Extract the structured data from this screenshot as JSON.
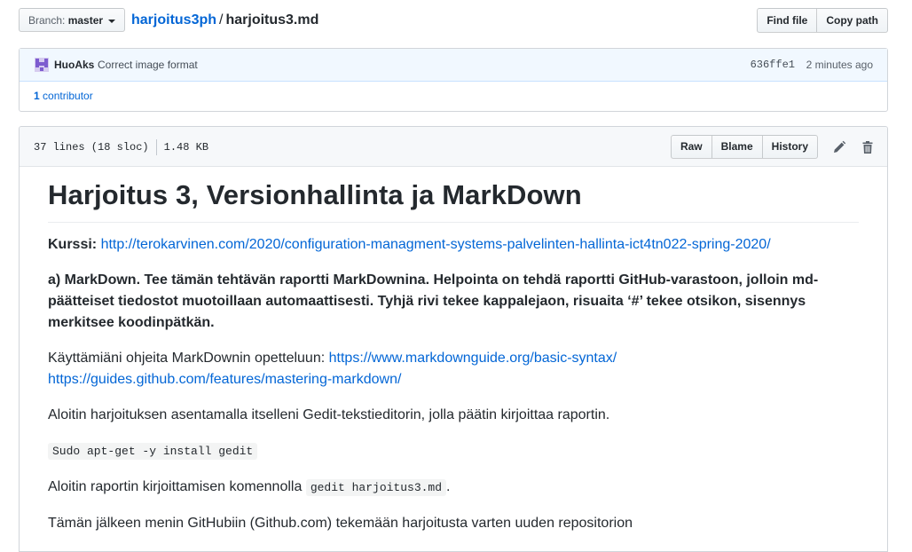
{
  "topbar": {
    "branch_label": "Branch:",
    "branch_name": "master",
    "repo": "harjoitus3ph",
    "separator": "/",
    "file": "harjoitus3.md",
    "find_file": "Find file",
    "copy_path": "Copy path"
  },
  "commit": {
    "author": "HuoAks",
    "message": "Correct image format",
    "sha": "636ffe1",
    "time": "2 minutes ago",
    "contributors_count": "1",
    "contributors_label": "contributor"
  },
  "file": {
    "lines": "37 lines (18 sloc)",
    "size": "1.48 KB",
    "raw": "Raw",
    "blame": "Blame",
    "history": "History"
  },
  "content": {
    "title": "Harjoitus 3, Versionhallinta ja MarkDown",
    "course_label": "Kurssi:",
    "course_link": "http://terokarvinen.com/2020/configuration-managment-systems-palvelinten-hallinta-ict4tn022-spring-2020/",
    "task_a": "a) MarkDown. Tee tämän tehtävän raportti MarkDownina. Helpointa on tehdä raportti GitHub-varastoon, jolloin md-päätteiset tiedostot muotoillaan automaattisesti. Tyhjä rivi tekee kappalejaon, risuaita ‘#’ tekee otsikon, sisennys merkitsee koodinpätkän.",
    "guides_text": "Käyttämiäni ohjeita MarkDownin opetteluun:",
    "guide_link_1": "https://www.markdownguide.org/basic-syntax/",
    "guide_link_2": "https://guides.github.com/features/mastering-markdown/",
    "para_gedit": "Aloitin harjoituksen asentamalla itselleni Gedit-tekstieditorin, jolla päätin kirjoittaa raportin.",
    "code_install": "Sudo apt-get -y install gedit",
    "para_start_pre": "Aloitin raportin kirjoittamisen komennolla",
    "code_open": "gedit harjoitus3.md",
    "para_start_post": ".",
    "para_github": "Tämän jälkeen menin GitHubiin (Github.com) tekemään harjoitusta varten uuden repositorion"
  }
}
